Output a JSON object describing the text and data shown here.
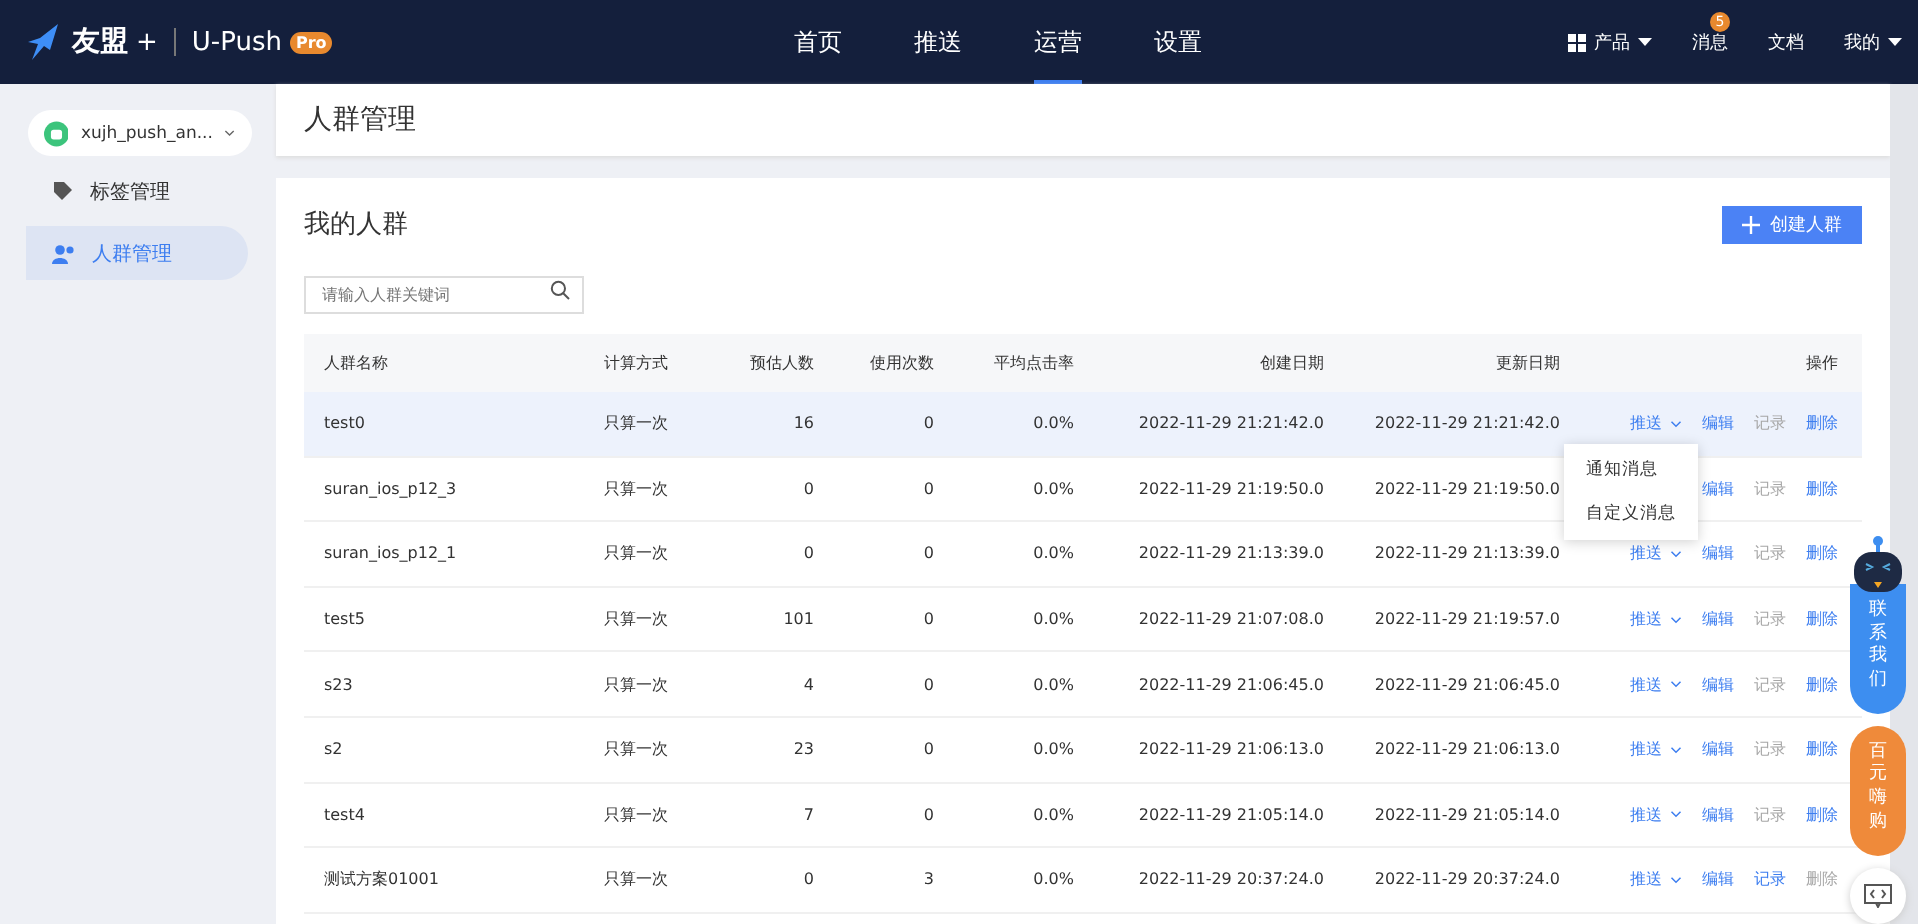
{
  "header": {
    "brand": "友盟",
    "plus": "+",
    "product": "U-Push",
    "badge": "Pro",
    "nav": [
      {
        "label": "首页",
        "selected": false
      },
      {
        "label": "推送",
        "selected": false
      },
      {
        "label": "运营",
        "selected": true
      },
      {
        "label": "设置",
        "selected": false
      }
    ],
    "right": [
      {
        "kind": "products",
        "label": "产品"
      },
      {
        "kind": "messages",
        "label": "消息",
        "count": "5"
      },
      {
        "kind": "docs",
        "label": "文档"
      },
      {
        "kind": "account",
        "label": "我的"
      }
    ]
  },
  "sidebar": {
    "app": "xujh_push_an...",
    "items": [
      {
        "kind": "tags",
        "label": "标签管理",
        "selected": false
      },
      {
        "kind": "groups",
        "label": "人群管理",
        "selected": true
      }
    ]
  },
  "page_title": "人群管理",
  "panel": {
    "title": "我的人群",
    "create_button": "创建人群",
    "search": {
      "placeholder": "请输入人群关键词"
    }
  },
  "table": {
    "columns": [
      "人群名称",
      "计算方式",
      "预估人数",
      "使用次数",
      "平均点击率",
      "创建日期",
      "更新日期",
      "操作"
    ],
    "rows": [
      {
        "highlighted": true,
        "cells": [
          "test0",
          "只算一次",
          "16",
          "0",
          "0.0%",
          "2022-11-29 21:21:42.0",
          "2022-11-29 21:21:42.0"
        ],
        "push": "推送",
        "edit": "编辑",
        "record": {
          "label": "记录",
          "disabled": true
        },
        "delete": {
          "label": "删除",
          "disabled": false
        }
      },
      {
        "highlighted": false,
        "cells": [
          "suran_ios_p12_3",
          "只算一次",
          "0",
          "0",
          "0.0%",
          "2022-11-29 21:19:50.0",
          "2022-11-29 21:19:50.0"
        ],
        "edit": "编辑",
        "record": {
          "label": "记录",
          "disabled": true
        },
        "delete": {
          "label": "删除",
          "disabled": false
        }
      },
      {
        "highlighted": false,
        "cells": [
          "suran_ios_p12_1",
          "只算一次",
          "0",
          "0",
          "0.0%",
          "2022-11-29 21:13:39.0",
          "2022-11-29 21:13:39.0"
        ],
        "push": "推送",
        "edit": "编辑",
        "record": {
          "label": "记录",
          "disabled": true
        },
        "delete": {
          "label": "删除",
          "disabled": false
        }
      },
      {
        "highlighted": false,
        "cells": [
          "test5",
          "只算一次",
          "101",
          "0",
          "0.0%",
          "2022-11-29 21:07:08.0",
          "2022-11-29 21:19:57.0"
        ],
        "push": "推送",
        "edit": "编辑",
        "record": {
          "label": "记录",
          "disabled": true
        },
        "delete": {
          "label": "删除",
          "disabled": false
        }
      },
      {
        "highlighted": false,
        "cells": [
          "s23",
          "只算一次",
          "4",
          "0",
          "0.0%",
          "2022-11-29 21:06:45.0",
          "2022-11-29 21:06:45.0"
        ],
        "push": "推送",
        "edit": "编辑",
        "record": {
          "label": "记录",
          "disabled": true
        },
        "delete": {
          "label": "删除",
          "disabled": false
        }
      },
      {
        "highlighted": false,
        "cells": [
          "s2",
          "只算一次",
          "23",
          "0",
          "0.0%",
          "2022-11-29 21:06:13.0",
          "2022-11-29 21:06:13.0"
        ],
        "push": "推送",
        "edit": "编辑",
        "record": {
          "label": "记录",
          "disabled": true
        },
        "delete": {
          "label": "删除",
          "disabled": false
        }
      },
      {
        "highlighted": false,
        "cells": [
          "test4",
          "只算一次",
          "7",
          "0",
          "0.0%",
          "2022-11-29 21:05:14.0",
          "2022-11-29 21:05:14.0"
        ],
        "push": "推送",
        "edit": "编辑",
        "record": {
          "label": "记录",
          "disabled": true
        },
        "delete": {
          "label": "删除",
          "disabled": false
        }
      },
      {
        "highlighted": false,
        "cells": [
          "测试方案01001",
          "只算一次",
          "0",
          "3",
          "0.0%",
          "2022-11-29 20:37:24.0",
          "2022-11-29 20:37:24.0"
        ],
        "push": "推送",
        "edit": "编辑",
        "record": {
          "label": "记录",
          "disabled": false
        },
        "delete": {
          "label": "删除",
          "disabled": true
        }
      }
    ]
  },
  "push_menu": [
    "通知消息",
    "自定义消息"
  ],
  "floating": {
    "contact": "联系我们",
    "promo": "百元嗨购"
  }
}
